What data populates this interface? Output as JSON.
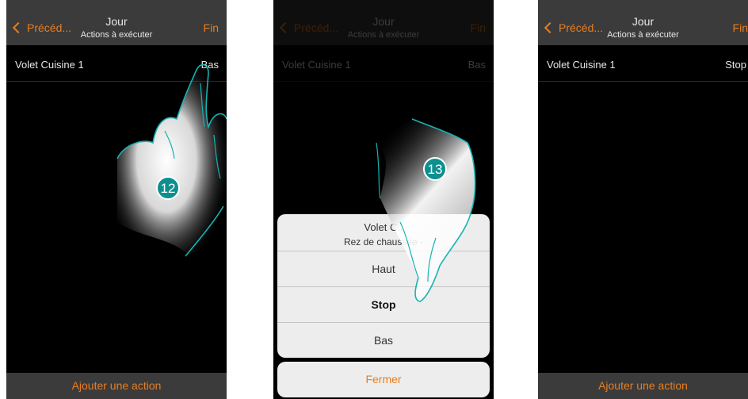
{
  "screens": [
    {
      "header": {
        "back_label": "Précéd...",
        "title": "Jour",
        "subtitle": "Actions à exécuter",
        "done_label": "Fin"
      },
      "row": {
        "label": "Volet Cuisine 1",
        "value": "Bas"
      },
      "footer": {
        "add_label": "Ajouter une action"
      },
      "step": "12"
    },
    {
      "header": {
        "back_label": "Précéd...",
        "title": "Jour",
        "subtitle": "Actions à exécuter",
        "done_label": "Fin"
      },
      "row": {
        "label": "Volet Cuisine 1",
        "value": "Bas"
      },
      "sheet": {
        "title": "Volet Cu",
        "subtitle": "Rez de chaussée -",
        "options": [
          "Haut",
          "Stop",
          "Bas"
        ],
        "selected": "Stop",
        "close_label": "Fermer"
      },
      "step": "13"
    },
    {
      "header": {
        "back_label": "Précéd...",
        "title": "Jour",
        "subtitle": "Actions à exécuter",
        "done_label": "Fin"
      },
      "row": {
        "label": "Volet Cuisine 1",
        "value": "Stop"
      },
      "footer": {
        "add_label": "Ajouter une action"
      }
    }
  ],
  "colors": {
    "accent": "#e67e22",
    "badge": "#0e8f8f",
    "hand_outline": "#17b3b3"
  }
}
